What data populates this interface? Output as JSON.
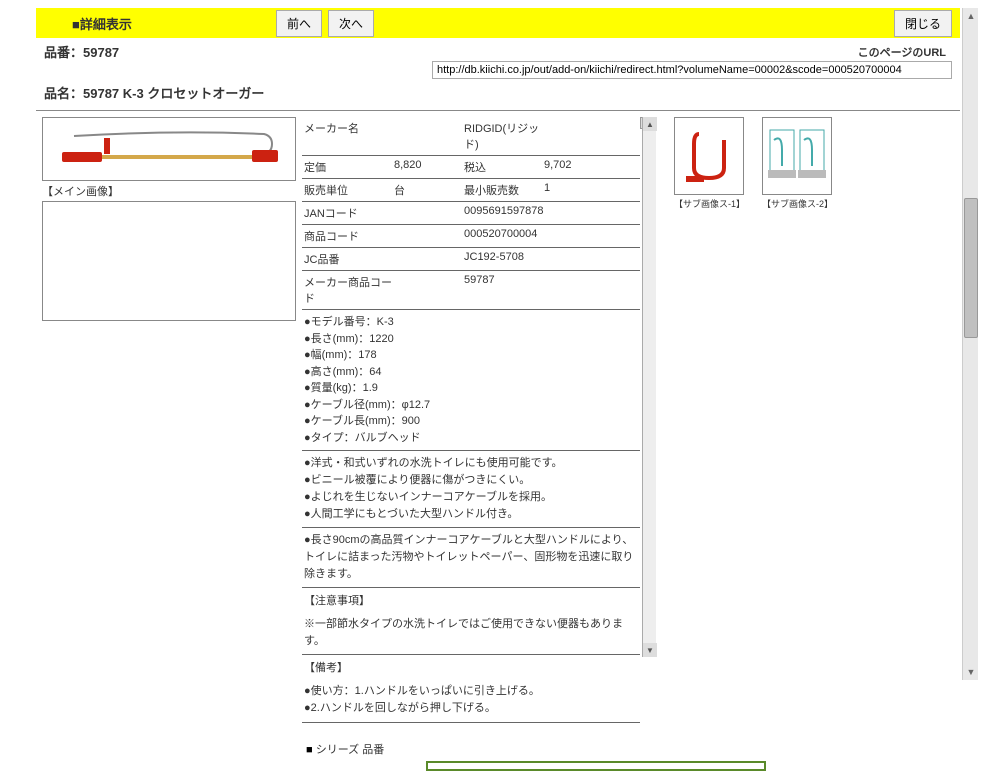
{
  "header": {
    "title": "■詳細表示",
    "prev_label": "前へ",
    "next_label": "次へ",
    "close_label": "閉じる"
  },
  "url_section": {
    "label": "このページのURL",
    "value": "http://db.kiichi.co.jp/out/add-on/kiichi/redirect.html?volumeName=00002&scode=000520700004"
  },
  "product": {
    "code_label": "品番：",
    "code": "59787",
    "name_label": "品名：",
    "name": "59787 K-3 クロセットオーガー"
  },
  "main_image_caption": "【メイン画像】",
  "spec_rows": [
    {
      "label": "メーカー名",
      "v1": "",
      "label2": "RIDGID(リジッド)",
      "v2": ""
    },
    {
      "label": "定価",
      "v1": "8,820",
      "label2": "税込",
      "v2": "9,702"
    },
    {
      "label": "販売単位",
      "v1": "台",
      "label2": "最小販売数",
      "v2": "1"
    },
    {
      "label": "JANコード",
      "v1": "",
      "label2": "0095691597878",
      "v2": ""
    },
    {
      "label": "商品コード",
      "v1": "",
      "label2": "000520700004",
      "v2": ""
    },
    {
      "label": "JC品番",
      "v1": "",
      "label2": "JC192-5708",
      "v2": ""
    },
    {
      "label": "メーカー商品コード",
      "v1": "",
      "label2": "59787",
      "v2": ""
    }
  ],
  "spec_block": "●モデル番号：K-3\n●長さ(mm)：1220\n●幅(mm)：178\n●高さ(mm)：64\n●質量(kg)：1.9\n●ケーブル径(mm)：φ12.7\n●ケーブル長(mm)：900\n●タイプ：バルブヘッド",
  "feature_block": "●洋式・和式いずれの水洗トイレにも使用可能です。\n●ビニール被覆により便器に傷がつきにくい。\n●よじれを生じないインナーコアケーブルを採用。\n●人間工学にもとづいた大型ハンドル付き。",
  "desc_block": "●長さ90cmの高品質インナーコアケーブルと大型ハンドルにより、トイレに詰まった汚物やトイレットペーパー、固形物を迅速に取り除きます。",
  "caution_label": "【注意事項】",
  "caution_text": "※一部節水タイプの水洗トイレではご使用できない便器もあります。",
  "remarks_label": "【備考】",
  "remarks_text": "●使い方：1.ハンドルをいっぱいに引き上げる。\n●2.ハンドルを回しながら押し下げる。",
  "thumbs": [
    {
      "caption": "【サブ画像ス-1】",
      "icon": "hook-icon"
    },
    {
      "caption": "【サブ画像ス-2】",
      "icon": "diagram-icon"
    }
  ],
  "series_label": "シリーズ 品番"
}
